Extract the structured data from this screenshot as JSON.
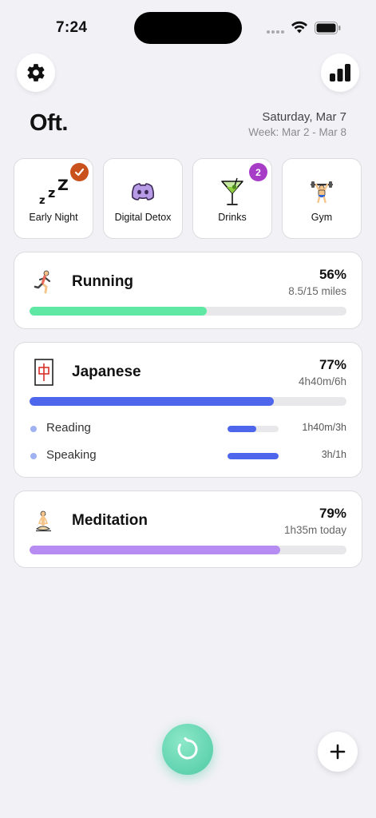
{
  "status_bar": {
    "time": "7:24"
  },
  "header": {
    "title": "Oft.",
    "date": "Saturday, Mar 7",
    "week": "Week: Mar 2 - Mar 8"
  },
  "habits": [
    {
      "label": "Early Night",
      "icon": "sleep-icon",
      "badge": "check",
      "badge_color": "#c9521c"
    },
    {
      "label": "Digital Detox",
      "icon": "discord-icon"
    },
    {
      "label": "Drinks",
      "icon": "cocktail-icon",
      "badge": "2",
      "badge_color": "#a73dc7"
    },
    {
      "label": "Gym",
      "icon": "weightlifter-icon"
    }
  ],
  "goals": [
    {
      "title": "Running",
      "icon": "runner-icon",
      "percent": "56%",
      "detail": "8.5/15 miles",
      "progress": 0.56,
      "color": "#5fe8a4"
    },
    {
      "title": "Japanese",
      "icon": "japanese-character-icon",
      "percent": "77%",
      "detail": "4h40m/6h",
      "progress": 0.77,
      "color": "#4d66ec",
      "subgoals": [
        {
          "label": "Reading",
          "value": "1h40m/3h",
          "progress": 0.56
        },
        {
          "label": "Speaking",
          "value": "3h/1h",
          "progress": 1.0
        }
      ]
    },
    {
      "title": "Meditation",
      "icon": "meditation-icon",
      "percent": "79%",
      "detail": "1h35m today",
      "progress": 0.79,
      "color": "#b68cf3"
    }
  ],
  "colors": {
    "background": "#f2f1f6",
    "accent_green": "#5fe8a4",
    "accent_blue": "#4d66ec",
    "accent_purple": "#b68cf3",
    "timer": "#4ec9a3"
  }
}
